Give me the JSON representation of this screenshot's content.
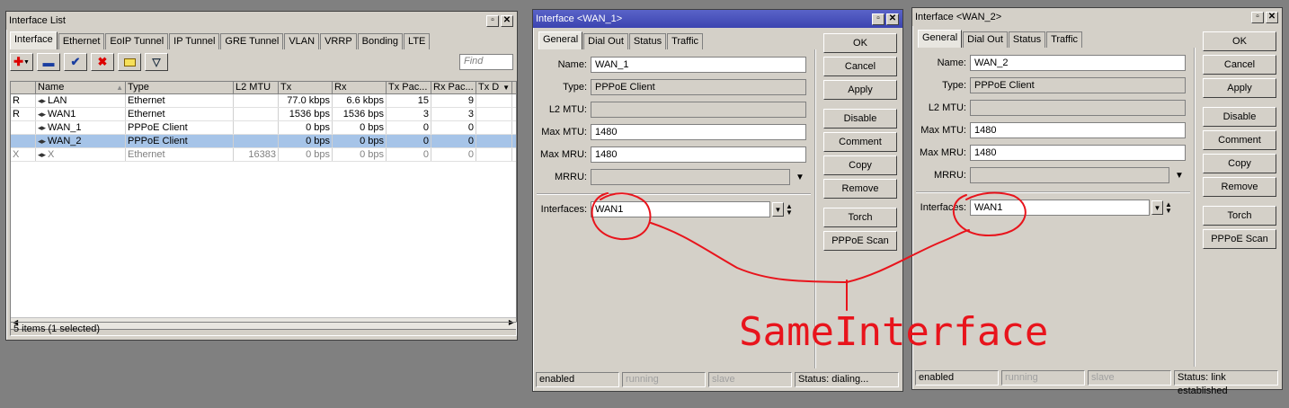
{
  "interface_list": {
    "title": "Interface List",
    "tabs": [
      "Interface",
      "Ethernet",
      "EoIP Tunnel",
      "IP Tunnel",
      "GRE Tunnel",
      "VLAN",
      "VRRP",
      "Bonding",
      "LTE"
    ],
    "find_placeholder": "Find",
    "columns": [
      "",
      "Name",
      "Type",
      "L2 MTU",
      "Tx",
      "Rx",
      "Tx Pac...",
      "Rx Pac...",
      "Tx D"
    ],
    "rows": [
      {
        "flag": "R",
        "name": "LAN",
        "type": "Ethernet",
        "l2mtu": "",
        "tx": "77.0 kbps",
        "rx": "6.6 kbps",
        "txp": "15",
        "rxp": "9",
        "selected": false,
        "disabled": false
      },
      {
        "flag": "R",
        "name": "WAN1",
        "type": "Ethernet",
        "l2mtu": "",
        "tx": "1536 bps",
        "rx": "1536 bps",
        "txp": "3",
        "rxp": "3",
        "selected": false,
        "disabled": false
      },
      {
        "flag": "",
        "name": "WAN_1",
        "type": "PPPoE Client",
        "l2mtu": "",
        "tx": "0 bps",
        "rx": "0 bps",
        "txp": "0",
        "rxp": "0",
        "selected": false,
        "disabled": false
      },
      {
        "flag": "",
        "name": "WAN_2",
        "type": "PPPoE Client",
        "l2mtu": "",
        "tx": "0 bps",
        "rx": "0 bps",
        "txp": "0",
        "rxp": "0",
        "selected": true,
        "disabled": false
      },
      {
        "flag": "X",
        "name": "X",
        "type": "Ethernet",
        "l2mtu": "16383",
        "tx": "0 bps",
        "rx": "0 bps",
        "txp": "0",
        "rxp": "0",
        "selected": false,
        "disabled": true
      }
    ],
    "status": "5 items (1 selected)"
  },
  "wan1": {
    "title": "Interface <WAN_1>",
    "tabs": [
      "General",
      "Dial Out",
      "Status",
      "Traffic"
    ],
    "labels": {
      "name": "Name:",
      "type": "Type:",
      "l2mtu": "L2 MTU:",
      "max_mtu": "Max MTU:",
      "max_mru": "Max MRU:",
      "mrru": "MRRU:",
      "interfaces": "Interfaces:"
    },
    "name": "WAN_1",
    "type": "PPPoE Client",
    "l2mtu": "",
    "max_mtu": "1480",
    "max_mru": "1480",
    "mrru": "",
    "interfaces": "WAN1",
    "buttons": [
      "OK",
      "Cancel",
      "Apply",
      "Disable",
      "Comment",
      "Copy",
      "Remove",
      "Torch",
      "PPPoE Scan"
    ],
    "status": {
      "enabled": "enabled",
      "running": "running",
      "slave": "slave",
      "state": "Status: dialing..."
    }
  },
  "wan2": {
    "title": "Interface <WAN_2>",
    "tabs": [
      "General",
      "Dial Out",
      "Status",
      "Traffic"
    ],
    "labels": {
      "name": "Name:",
      "type": "Type:",
      "l2mtu": "L2 MTU:",
      "max_mtu": "Max MTU:",
      "max_mru": "Max MRU:",
      "mrru": "MRRU:",
      "interfaces": "Interfaces:"
    },
    "name": "WAN_2",
    "type": "PPPoE Client",
    "l2mtu": "",
    "max_mtu": "1480",
    "max_mru": "1480",
    "mrru": "",
    "interfaces": "WAN1",
    "buttons": [
      "OK",
      "Cancel",
      "Apply",
      "Disable",
      "Comment",
      "Copy",
      "Remove",
      "Torch",
      "PPPoE Scan"
    ],
    "status": {
      "enabled": "enabled",
      "running": "running",
      "slave": "slave",
      "state": "Status: link established"
    }
  },
  "annotation": {
    "text": "SameInterface",
    "color": "#e8141c"
  }
}
